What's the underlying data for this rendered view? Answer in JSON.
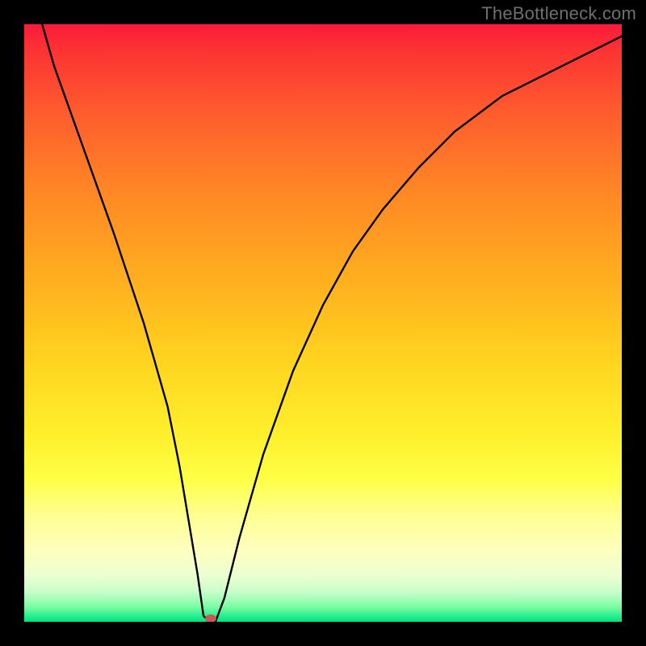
{
  "watermark": "TheBottleneck.com",
  "chart_data": {
    "type": "line",
    "title": "",
    "xlabel": "",
    "ylabel": "",
    "xlim": [
      0,
      100
    ],
    "ylim": [
      0,
      100
    ],
    "grid": false,
    "legend": false,
    "series": [
      {
        "name": "curve",
        "x": [
          3,
          5,
          10,
          15,
          20,
          24,
          26,
          27.5,
          29,
          30,
          31,
          32,
          33.5,
          36,
          40,
          45,
          50,
          55,
          60,
          66,
          72,
          80,
          88,
          96,
          100
        ],
        "values": [
          100,
          93,
          79,
          65,
          50,
          36,
          26,
          17,
          8,
          1,
          0,
          0,
          4,
          14,
          28,
          42,
          53,
          62,
          69,
          76,
          82,
          88,
          92,
          96,
          98
        ]
      }
    ],
    "marker": {
      "x": 31.2,
      "y": 0.5
    },
    "colors": {
      "curve": "#000000",
      "marker": "#c65a52",
      "frame": "#000000"
    }
  }
}
